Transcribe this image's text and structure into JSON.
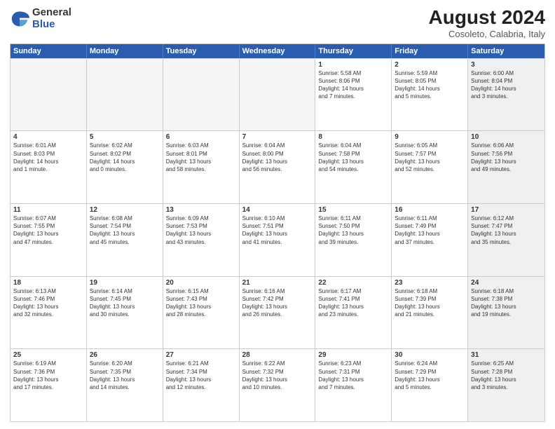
{
  "header": {
    "logo": {
      "general": "General",
      "blue": "Blue"
    },
    "title": "August 2024",
    "location": "Cosoleto, Calabria, Italy"
  },
  "weekdays": [
    "Sunday",
    "Monday",
    "Tuesday",
    "Wednesday",
    "Thursday",
    "Friday",
    "Saturday"
  ],
  "weeks": [
    [
      {
        "day": "",
        "info": "",
        "empty": true
      },
      {
        "day": "",
        "info": "",
        "empty": true
      },
      {
        "day": "",
        "info": "",
        "empty": true
      },
      {
        "day": "",
        "info": "",
        "empty": true
      },
      {
        "day": "1",
        "info": "Sunrise: 5:58 AM\nSunset: 8:06 PM\nDaylight: 14 hours\nand 7 minutes."
      },
      {
        "day": "2",
        "info": "Sunrise: 5:59 AM\nSunset: 8:05 PM\nDaylight: 14 hours\nand 5 minutes."
      },
      {
        "day": "3",
        "info": "Sunrise: 6:00 AM\nSunset: 8:04 PM\nDaylight: 14 hours\nand 3 minutes."
      }
    ],
    [
      {
        "day": "4",
        "info": "Sunrise: 6:01 AM\nSunset: 8:03 PM\nDaylight: 14 hours\nand 1 minute."
      },
      {
        "day": "5",
        "info": "Sunrise: 6:02 AM\nSunset: 8:02 PM\nDaylight: 14 hours\nand 0 minutes."
      },
      {
        "day": "6",
        "info": "Sunrise: 6:03 AM\nSunset: 8:01 PM\nDaylight: 13 hours\nand 58 minutes."
      },
      {
        "day": "7",
        "info": "Sunrise: 6:04 AM\nSunset: 8:00 PM\nDaylight: 13 hours\nand 56 minutes."
      },
      {
        "day": "8",
        "info": "Sunrise: 6:04 AM\nSunset: 7:58 PM\nDaylight: 13 hours\nand 54 minutes."
      },
      {
        "day": "9",
        "info": "Sunrise: 6:05 AM\nSunset: 7:57 PM\nDaylight: 13 hours\nand 52 minutes."
      },
      {
        "day": "10",
        "info": "Sunrise: 6:06 AM\nSunset: 7:56 PM\nDaylight: 13 hours\nand 49 minutes."
      }
    ],
    [
      {
        "day": "11",
        "info": "Sunrise: 6:07 AM\nSunset: 7:55 PM\nDaylight: 13 hours\nand 47 minutes."
      },
      {
        "day": "12",
        "info": "Sunrise: 6:08 AM\nSunset: 7:54 PM\nDaylight: 13 hours\nand 45 minutes."
      },
      {
        "day": "13",
        "info": "Sunrise: 6:09 AM\nSunset: 7:53 PM\nDaylight: 13 hours\nand 43 minutes."
      },
      {
        "day": "14",
        "info": "Sunrise: 6:10 AM\nSunset: 7:51 PM\nDaylight: 13 hours\nand 41 minutes."
      },
      {
        "day": "15",
        "info": "Sunrise: 6:11 AM\nSunset: 7:50 PM\nDaylight: 13 hours\nand 39 minutes."
      },
      {
        "day": "16",
        "info": "Sunrise: 6:11 AM\nSunset: 7:49 PM\nDaylight: 13 hours\nand 37 minutes."
      },
      {
        "day": "17",
        "info": "Sunrise: 6:12 AM\nSunset: 7:47 PM\nDaylight: 13 hours\nand 35 minutes."
      }
    ],
    [
      {
        "day": "18",
        "info": "Sunrise: 6:13 AM\nSunset: 7:46 PM\nDaylight: 13 hours\nand 32 minutes."
      },
      {
        "day": "19",
        "info": "Sunrise: 6:14 AM\nSunset: 7:45 PM\nDaylight: 13 hours\nand 30 minutes."
      },
      {
        "day": "20",
        "info": "Sunrise: 6:15 AM\nSunset: 7:43 PM\nDaylight: 13 hours\nand 28 minutes."
      },
      {
        "day": "21",
        "info": "Sunrise: 6:16 AM\nSunset: 7:42 PM\nDaylight: 13 hours\nand 26 minutes."
      },
      {
        "day": "22",
        "info": "Sunrise: 6:17 AM\nSunset: 7:41 PM\nDaylight: 13 hours\nand 23 minutes."
      },
      {
        "day": "23",
        "info": "Sunrise: 6:18 AM\nSunset: 7:39 PM\nDaylight: 13 hours\nand 21 minutes."
      },
      {
        "day": "24",
        "info": "Sunrise: 6:18 AM\nSunset: 7:38 PM\nDaylight: 13 hours\nand 19 minutes."
      }
    ],
    [
      {
        "day": "25",
        "info": "Sunrise: 6:19 AM\nSunset: 7:36 PM\nDaylight: 13 hours\nand 17 minutes."
      },
      {
        "day": "26",
        "info": "Sunrise: 6:20 AM\nSunset: 7:35 PM\nDaylight: 13 hours\nand 14 minutes."
      },
      {
        "day": "27",
        "info": "Sunrise: 6:21 AM\nSunset: 7:34 PM\nDaylight: 13 hours\nand 12 minutes."
      },
      {
        "day": "28",
        "info": "Sunrise: 6:22 AM\nSunset: 7:32 PM\nDaylight: 13 hours\nand 10 minutes."
      },
      {
        "day": "29",
        "info": "Sunrise: 6:23 AM\nSunset: 7:31 PM\nDaylight: 13 hours\nand 7 minutes."
      },
      {
        "day": "30",
        "info": "Sunrise: 6:24 AM\nSunset: 7:29 PM\nDaylight: 13 hours\nand 5 minutes."
      },
      {
        "day": "31",
        "info": "Sunrise: 6:25 AM\nSunset: 7:28 PM\nDaylight: 13 hours\nand 3 minutes."
      }
    ]
  ]
}
